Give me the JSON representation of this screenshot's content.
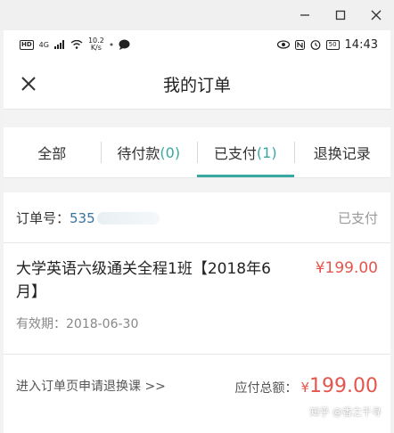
{
  "status_bar": {
    "hd": "HD",
    "network": "4G",
    "speed_value": "10.2",
    "speed_unit": "K/s",
    "battery": "50",
    "time": "14:43"
  },
  "header": {
    "title": "我的订单"
  },
  "tabs": [
    {
      "label": "全部",
      "count": ""
    },
    {
      "label": "待付款",
      "count": "(0)"
    },
    {
      "label": "已支付",
      "count": "(1)"
    },
    {
      "label": "退换记录",
      "count": ""
    }
  ],
  "order": {
    "number_label": "订单号：",
    "number_visible": "535",
    "status": "已支付",
    "item_title": "大学英语六级通关全程1班【2018年6月】",
    "item_price": "¥199.00",
    "valid_label": "有效期：",
    "valid_date": "2018-06-30"
  },
  "footer": {
    "refund_link": "进入订单页申请退换课 >>",
    "total_label": "应付总额：",
    "total_currency": "¥",
    "total_value": "199.00"
  },
  "watermark": "知乎 @香之千寻"
}
